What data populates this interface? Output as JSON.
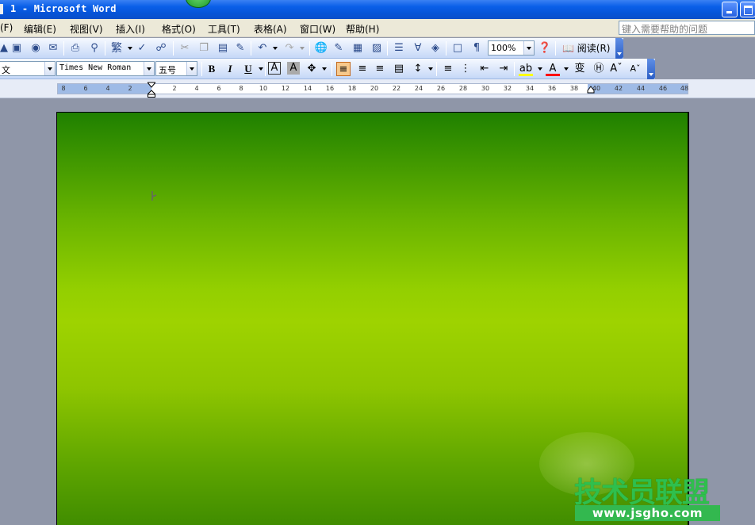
{
  "window": {
    "title": "1 - Microsoft Word",
    "minimize_label": "minimize",
    "restore_label": "restore"
  },
  "menu": {
    "items": [
      "(F)",
      "编辑(E)",
      "视图(V)",
      "插入(I)",
      "格式(O)",
      "工具(T)",
      "表格(A)",
      "窗口(W)",
      "帮助(H)"
    ],
    "help_placeholder": "键入需要帮助的问题"
  },
  "toolbar1": {
    "zoom": "100%",
    "read_label": "阅读(R)"
  },
  "toolbar2": {
    "style": "文",
    "font": "Times New Roman",
    "size": "五号",
    "bold": "B",
    "italic": "I",
    "underline": "U"
  },
  "ruler": {
    "ticks": [
      "8",
      "6",
      "4",
      "2",
      "2",
      "4",
      "6",
      "8",
      "10",
      "12",
      "14",
      "16",
      "18",
      "20",
      "22",
      "24",
      "26",
      "28",
      "30",
      "32",
      "34",
      "36",
      "38",
      "40",
      "42",
      "44",
      "46",
      "48"
    ]
  },
  "page": {
    "background_top": "#1f8000",
    "background_mid": "#9ed300",
    "background_bottom": "#3d8a00"
  },
  "watermark": {
    "logo_text": "技术员联盟",
    "url": "www.jsgho.com"
  },
  "colors": {
    "titlebar": "#0a5fe8",
    "menubar": "#ece9d8",
    "toolbar": "#c5d8f7",
    "workspace": "#8f96a8"
  }
}
